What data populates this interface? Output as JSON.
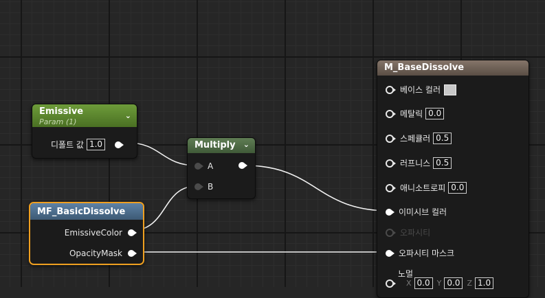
{
  "nodes": {
    "emissive": {
      "title": "Emissive",
      "subtitle": "Param (1)",
      "pin_label": "디폴트 값",
      "value": "1.0"
    },
    "multiply": {
      "title": "Multiply",
      "pin_a": "A",
      "pin_b": "B"
    },
    "function": {
      "title": "MF_BasicDissolve",
      "out_emissive": "EmissiveColor",
      "out_opacity": "OpacityMask"
    },
    "material": {
      "title": "M_BaseDissolve",
      "base_color": "베이스 컬러",
      "metallic": "메탈릭",
      "metallic_value": "0.0",
      "specular": "스페큘러",
      "specular_value": "0.5",
      "roughness": "러프니스",
      "roughness_value": "0.5",
      "anisotropy": "애니소트로피",
      "anisotropy_value": "0.0",
      "emissive_color": "이미시브 컬러",
      "opacity": "오파시티",
      "opacity_mask": "오파시티 마스크",
      "normal": "노멀",
      "normal_x_label": "X",
      "normal_x": "0.0",
      "normal_y_label": "Y",
      "normal_y": "0.0",
      "normal_z_label": "Z",
      "normal_z": "1.0"
    }
  },
  "colors": {
    "emissive_header": "#5e8a2e",
    "multiply_header": "#4f6b45",
    "function_header": "#4f6f8c",
    "material_header": "#6e6258",
    "selection": "#f0a020",
    "wire": "#f2f2f2"
  },
  "icons": [
    "chevron-down-icon",
    "pin-dot-icon",
    "pin-ring-icon"
  ]
}
